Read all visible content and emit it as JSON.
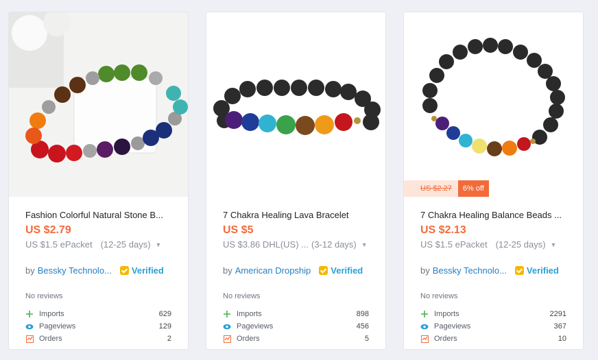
{
  "colors": {
    "accent": "#f26b3a",
    "link": "#2680c2",
    "verified": "#2a9fd6"
  },
  "products": [
    {
      "title": "Fashion Colorful Natural Stone B...",
      "price": "US $2.79",
      "shipping": "US $1.5 ePacket",
      "days": "(12-25 days)",
      "by": "by",
      "seller": "Bessky Technolo...",
      "verified": "Verified",
      "reviews": "No reviews",
      "stats": {
        "imports_label": "Imports",
        "imports": "629",
        "pageviews_label": "Pageviews",
        "pageviews": "129",
        "orders_label": "Orders",
        "orders": "2"
      }
    },
    {
      "title": "7 Chakra Healing Lava Bracelet",
      "price": "US $5",
      "shipping": "US $3.86 DHL(US) ...",
      "days": "(3-12 days)",
      "by": "by",
      "seller": "American Dropship",
      "verified": "Verified",
      "reviews": "No reviews",
      "stats": {
        "imports_label": "Imports",
        "imports": "898",
        "pageviews_label": "Pageviews",
        "pageviews": "456",
        "orders_label": "Orders",
        "orders": "5"
      }
    },
    {
      "title": "7 Chakra Healing Balance Beads ...",
      "price": "US $2.13",
      "old_price": "US $2.27",
      "discount": "6% off",
      "shipping": "US $1.5 ePacket",
      "days": "(12-25 days)",
      "by": "by",
      "seller": "Bessky Technolo...",
      "verified": "Verified",
      "reviews": "No reviews",
      "stats": {
        "imports_label": "Imports",
        "imports": "2291",
        "pageviews_label": "Pageviews",
        "pageviews": "367",
        "orders_label": "Orders",
        "orders": "10"
      }
    }
  ]
}
